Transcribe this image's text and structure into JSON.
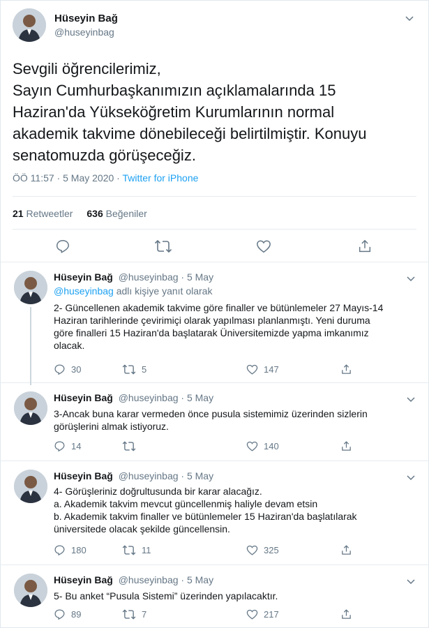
{
  "main_tweet": {
    "author_name": "Hüseyin Bağ",
    "author_handle": "@huseyinbag",
    "text_lines": [
      "Sevgili öğrencilerimiz,",
      "Sayın Cumhurbaşkanımızın açıklamalarında 15",
      "Haziran'da Yükseköğretim Kurumlarının normal",
      "akademik takvime dönebileceği belirtilmiştir. Konuyu",
      "senatomuzda görüşeceğiz."
    ],
    "timestamp": "ÖÖ 11:57 · 5 May 2020 · ",
    "source": "Twitter for iPhone",
    "retweet_count": "21",
    "retweet_label": "Retweetler",
    "like_count": "636",
    "like_label": "Beğeniler",
    "actions": [
      "reply-icon",
      "retweet-icon",
      "like-icon",
      "share-icon"
    ]
  },
  "replies": [
    {
      "author_name": "Hüseyin Bağ",
      "author_handle": "@huseyinbag",
      "date": "· 5 May",
      "reply_to_handle": "@huseyinbag",
      "reply_to_suffix": " adlı kişiye yanıt olarak",
      "text_lines": [
        "2- Güncellenen akademik takvime göre finaller ve bütünlemeler 27 Mayıs-14",
        "Haziran tarihlerinde çevirimiçi olarak yapılması planlanmıştı. Yeni duruma",
        "göre finalleri 15 Haziran'da başlatarak Üniversitemizde yapma imkanımız",
        "olacak."
      ],
      "reply_count": "30",
      "retweet_count": "5",
      "like_count": "147"
    },
    {
      "author_name": "Hüseyin Bağ",
      "author_handle": "@huseyinbag",
      "date": "· 5 May",
      "text_lines": [
        "3-Ancak buna karar vermeden önce pusula sistemimiz üzerinden sizlerin",
        "görüşlerini almak istiyoruz."
      ],
      "reply_count": "14",
      "retweet_count": "",
      "like_count": "140"
    },
    {
      "author_name": "Hüseyin Bağ",
      "author_handle": "@huseyinbag",
      "date": "· 5 May",
      "text_lines": [
        "4- Görüşleriniz doğrultusunda bir karar alacağız.",
        "a. Akademik takvim mevcut güncellenmiş haliyle devam etsin",
        "b. Akademik takvim finaller ve bütünlemeler 15 Haziran'da başlatılarak",
        "üniversitede olacak şekilde güncellensin."
      ],
      "reply_count": "180",
      "retweet_count": "11",
      "like_count": "325"
    },
    {
      "author_name": "Hüseyin Bağ",
      "author_handle": "@huseyinbag",
      "date": "· 5 May",
      "text_lines": [
        "5- Bu anket “Pusula Sistemi” üzerinden yapılacaktır."
      ],
      "reply_count": "89",
      "retweet_count": "7",
      "like_count": "217"
    }
  ],
  "colors": {
    "link": "#1da1f2",
    "secondary_text": "#657786",
    "primary_text": "#14171a",
    "divider": "#e6ecf0"
  }
}
